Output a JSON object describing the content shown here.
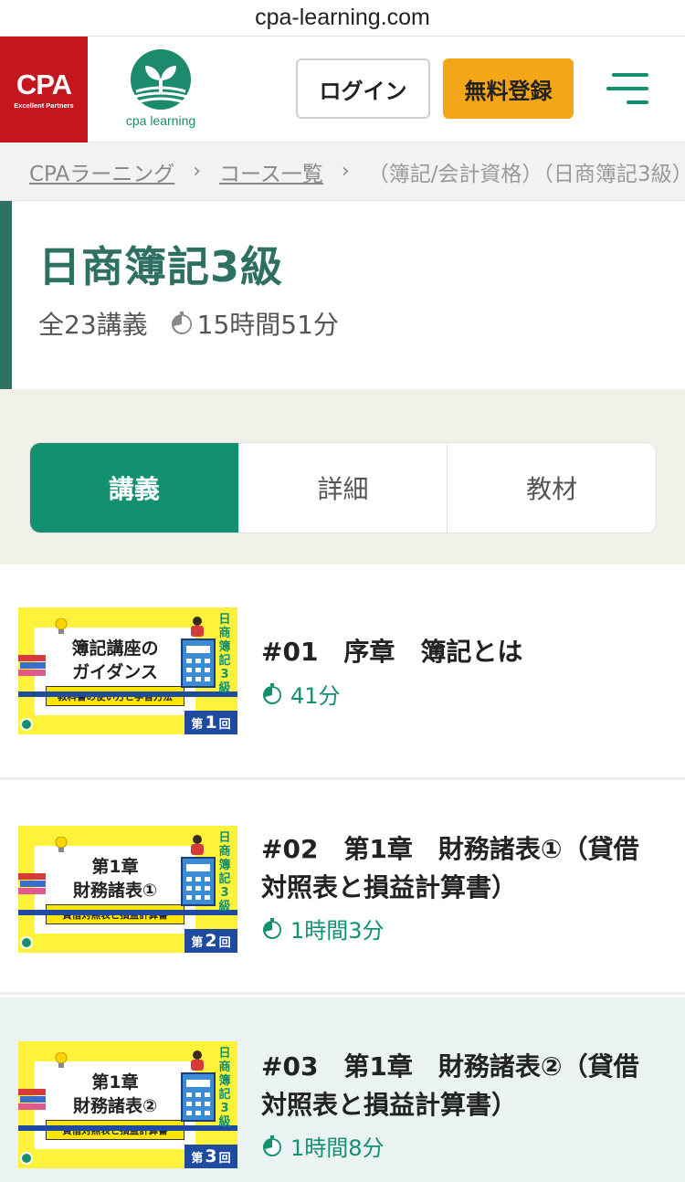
{
  "browser": {
    "url": "cpa-learning.com"
  },
  "header": {
    "cpa_logo_text": "CPA",
    "cpa_logo_sub": "Excellent Partners",
    "learning_logo_text": "cpa learning",
    "login_label": "ログイン",
    "register_label": "無料登録"
  },
  "breadcrumb": {
    "items": [
      "CPAラーニング",
      "コース一覧",
      "（簿記/会計資格）（日商簿記3級）"
    ]
  },
  "course": {
    "title": "日商簿記3級",
    "lecture_count": "全23講義",
    "total_time": "15時間51分"
  },
  "tabs": [
    {
      "label": "講義",
      "active": true
    },
    {
      "label": "詳細",
      "active": false
    },
    {
      "label": "教材",
      "active": false
    }
  ],
  "lectures": [
    {
      "title": "#01　序章　簿記とは",
      "duration": "41分",
      "thumb": {
        "line1": "簿記講座の",
        "line2": "ガイダンス",
        "band": "教科書の使い方と学習方法",
        "vertical": "日商簿記3級",
        "badge_pre": "第",
        "badge_num": "1",
        "badge_post": "回"
      }
    },
    {
      "title": "#02　第1章　財務諸表①（貸借対照表と損益計算書）",
      "duration": "1時間3分",
      "thumb": {
        "line1": "第1章",
        "line2": "財務諸表①",
        "band": "貸借対照表と損益計算書",
        "vertical": "日商簿記3級",
        "badge_pre": "第",
        "badge_num": "2",
        "badge_post": "回"
      }
    },
    {
      "title": "#03　第1章　財務諸表②（貸借対照表と損益計算書）",
      "duration": "1時間8分",
      "thumb": {
        "line1": "第1章",
        "line2": "財務諸表②",
        "band": "貸借対照表と損益計算書",
        "vertical": "日商簿記3級",
        "badge_pre": "第",
        "badge_num": "3",
        "badge_post": "回"
      }
    }
  ],
  "colors": {
    "brand_green": "#12906f",
    "title_green": "#2e7062",
    "register_orange": "#f3a617",
    "cpa_red": "#c4171d",
    "thumb_yellow": "#fff23a"
  },
  "icons": [
    "clock-icon",
    "hamburger-menu-icon",
    "chevron-right-icon"
  ]
}
